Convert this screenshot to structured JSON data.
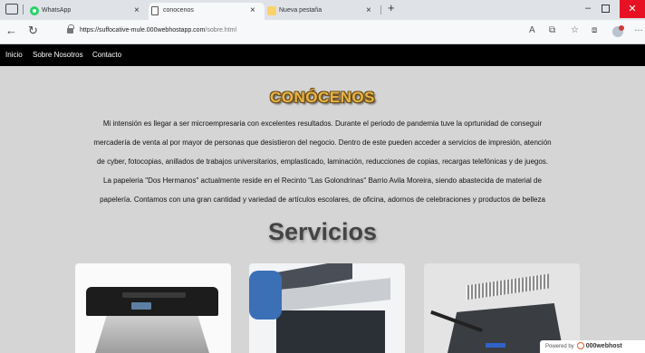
{
  "browser": {
    "tabs": [
      {
        "title": "WhatsApp",
        "active": false
      },
      {
        "title": "conocenos",
        "active": true
      },
      {
        "title": "Nueva pestaña",
        "active": false
      }
    ],
    "tab_close_glyph": "×",
    "new_tab_glyph": "+",
    "url_host": "https://suffocative-mule.000webhostapp.com",
    "url_path": "/sobre.html",
    "icons": [
      "tab-actions-icon",
      "whatsapp-icon",
      "document-icon",
      "new-tab-icon",
      "back-icon",
      "reload-icon",
      "lock-icon",
      "read-aloud-icon",
      "extensions-icon",
      "favorites-icon",
      "collections-icon",
      "profile-icon",
      "more-icon"
    ]
  },
  "site": {
    "nav": [
      "Inicio",
      "Sobre Nosotros",
      "Contacto"
    ],
    "heading": "CONÓCENOS",
    "intro_lines": [
      "Mi intensión es llegar a ser microempresaria con excelentes resultados. Durante el periodo de pandemia tuve la oprtunidad de conseguir",
      "mercadería de venta al por mayor de personas que desistieron del negocio. Dentro de este pueden acceder a servicios de impresión, atención",
      "de cyber, fotocopias, anillados de trabajos universitarios, emplasticado, laminación, reducciones de copias, recargas telefónicas y de juegos.",
      "La papeleria \"Dos Hermanos\" actualmente reside en el Recinto \"Las Golondrinas\" Barrio Avila Moreira, siendo abastecida de material de",
      "papelería. Contamos con una gran cantidad y variedad de artículos escolares, de oficina, adornos de celebraciones y productos de belleza"
    ],
    "services_title": "Servicios",
    "service_images": [
      "printer-image",
      "copier-image",
      "binding-machine-image"
    ]
  },
  "badge": {
    "prefix": "Powered by",
    "brand": "000webhost"
  },
  "colors": {
    "nav_bg": "#000000",
    "page_bg": "#d5d5d5",
    "heading": "#e8b54a",
    "close_button": "#e81123"
  }
}
